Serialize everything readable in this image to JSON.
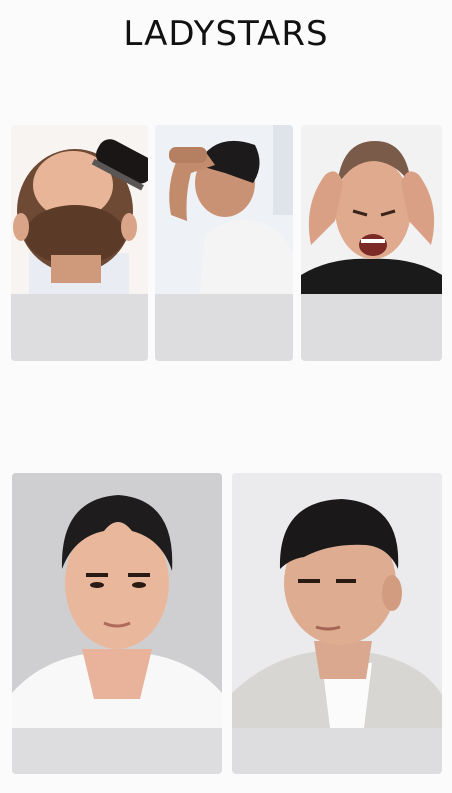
{
  "brand": {
    "name": "LADYSTARS"
  },
  "problem_photos": [
    {
      "icon": "balding-crown-with-brush"
    },
    {
      "icon": "man-holding-forehead"
    },
    {
      "icon": "man-shouting-hands-on-head"
    }
  ],
  "result_photos": [
    {
      "icon": "man-front-short-hair"
    },
    {
      "icon": "man-side-crew-cut"
    }
  ]
}
